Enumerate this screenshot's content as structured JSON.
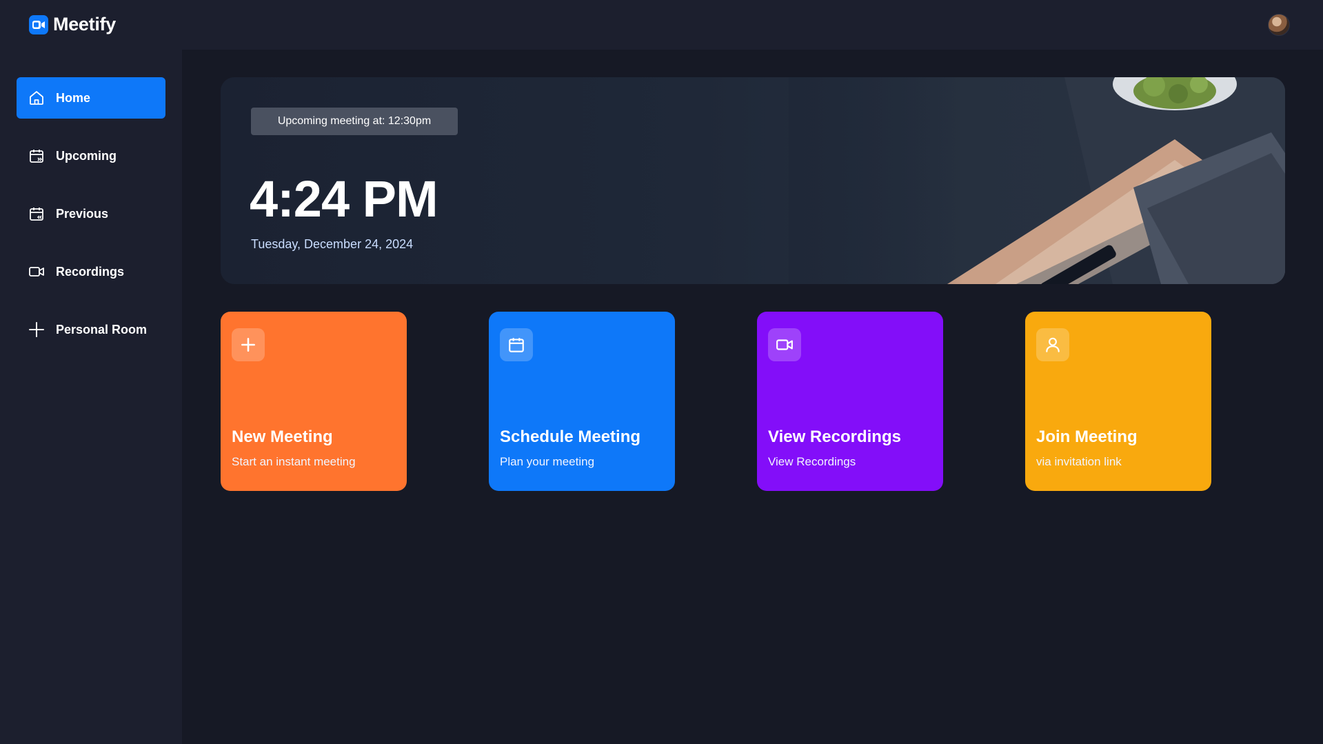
{
  "app": {
    "name": "Meetify",
    "logo_icon": "video-camera-icon"
  },
  "header": {
    "avatar_icon": "user-avatar"
  },
  "sidebar": {
    "items": [
      {
        "label": "Home",
        "icon": "home-icon",
        "active": true
      },
      {
        "label": "Upcoming",
        "icon": "calendar-upcoming-icon",
        "active": false
      },
      {
        "label": "Previous",
        "icon": "calendar-previous-icon",
        "active": false
      },
      {
        "label": "Recordings",
        "icon": "video-icon",
        "active": false
      },
      {
        "label": "Personal Room",
        "icon": "plus-icon",
        "active": false
      }
    ]
  },
  "hero": {
    "badge": "Upcoming meeting at: 12:30pm",
    "time": "4:24 PM",
    "date": "Tuesday, December 24, 2024"
  },
  "cards": [
    {
      "title": "New Meeting",
      "subtitle": "Start an instant meeting",
      "icon": "plus-icon",
      "color": "#ff742e"
    },
    {
      "title": "Schedule Meeting",
      "subtitle": "Plan your meeting",
      "icon": "calendar-icon",
      "color": "#0e78f9"
    },
    {
      "title": "View Recordings",
      "subtitle": "View Recordings",
      "icon": "video-icon",
      "color": "#830ef9"
    },
    {
      "title": "Join Meeting",
      "subtitle": "via invitation link",
      "icon": "user-icon",
      "color": "#f9a90e"
    }
  ],
  "colors": {
    "accent": "#0e78f9",
    "background": "#161925",
    "panel": "#1c1f2e"
  }
}
